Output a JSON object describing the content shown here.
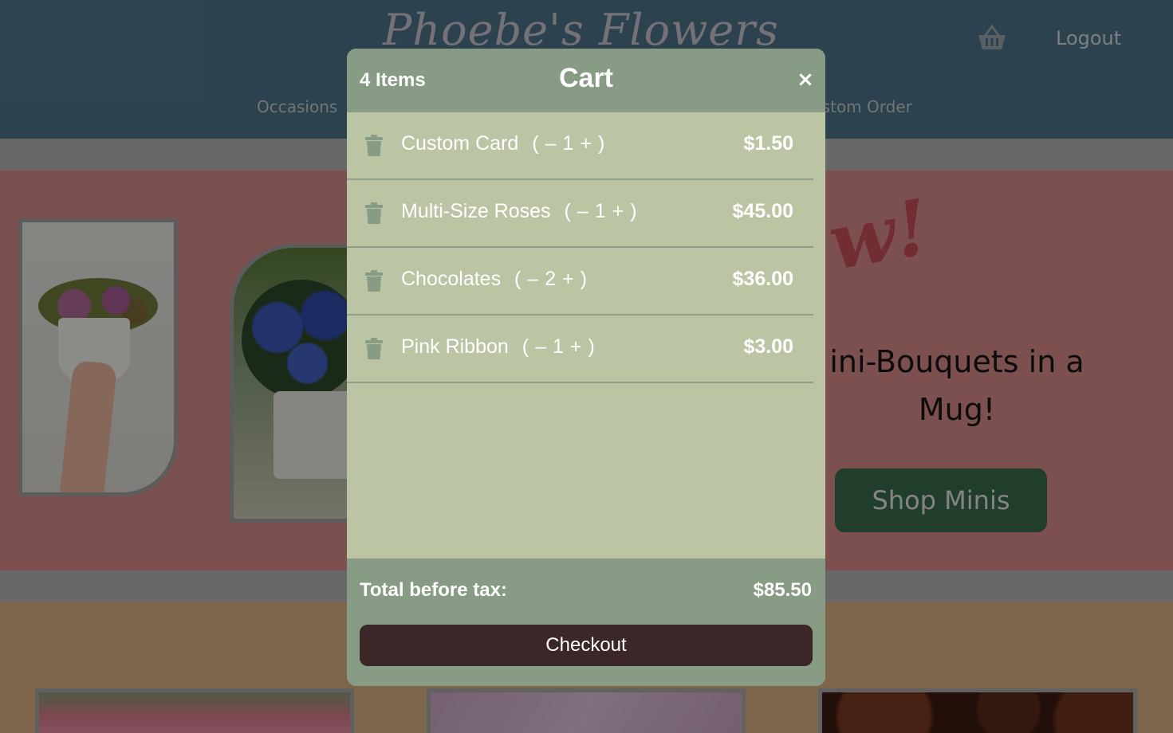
{
  "header": {
    "brand": "Phoebe's Flowers",
    "logout_label": "Logout",
    "nav_left": "Occasions",
    "nav_right": "ustom Order"
  },
  "hero": {
    "badge_text": "w!",
    "subtitle": "ini-Bouquets in a Mug!",
    "shop_button": "Shop Minis"
  },
  "cart": {
    "item_count": "4 Items",
    "title": "Cart",
    "close_symbol": "×",
    "items": [
      {
        "name": "Custom Card",
        "qty": "1",
        "price": "$1.50"
      },
      {
        "name": "Multi-Size Roses",
        "qty": "1",
        "price": "$45.00"
      },
      {
        "name": "Chocolates",
        "qty": "2",
        "price": "$36.00"
      },
      {
        "name": "Pink Ribbon",
        "qty": "1",
        "price": "$3.00"
      }
    ],
    "qty_minus": "–",
    "qty_plus": "+",
    "paren_open": "(",
    "paren_close": ")",
    "total_label": "Total before tax:",
    "total_value": "$85.50",
    "checkout_label": "Checkout"
  },
  "icons": {
    "cart": "basket-icon",
    "trash": "trash-icon",
    "close": "close-icon"
  },
  "colors": {
    "header_bg": "#4f7388",
    "hero_bg": "#d88a8a",
    "modal_body": "#bcc5a3",
    "modal_bar": "#889b84",
    "checkout_bg": "#3b2727",
    "shop_button_bg": "#3a6b4f"
  }
}
